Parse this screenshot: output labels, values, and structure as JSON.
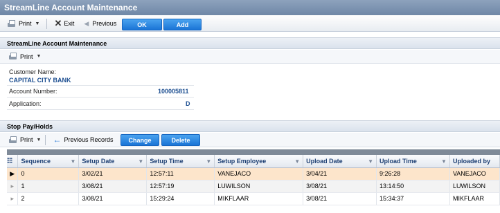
{
  "window": {
    "title": "StreamLine Account Maintenance"
  },
  "toolbar": {
    "print_label": "Print",
    "exit_label": "Exit",
    "previous_label": "Previous",
    "ok_label": "OK",
    "add_label": "Add"
  },
  "account_section": {
    "title": "StreamLine Account Maintenance",
    "print_label": "Print",
    "customer_name_label": "Customer Name:",
    "customer_name_value": "CAPITAL CITY BANK",
    "account_number_label": "Account Number:",
    "account_number_value": "100005811",
    "application_label": "Application:",
    "application_value": "D"
  },
  "stop_pay_section": {
    "title": "Stop Pay/Holds",
    "print_label": "Print",
    "previous_records_label": "Previous Records",
    "change_label": "Change",
    "delete_label": "Delete"
  },
  "grid": {
    "columns": [
      "Sequence",
      "Setup Date",
      "Setup Time",
      "Setup Employee",
      "Upload Date",
      "Upload Time",
      "Uploaded by"
    ],
    "rows": [
      [
        "0",
        "3/02/21",
        "12:57:11",
        "VANEJACO",
        "3/04/21",
        "9:26:28",
        "VANEJACO"
      ],
      [
        "1",
        "3/08/21",
        "12:57:19",
        "LUWILSON",
        "3/08/21",
        "13:14:50",
        "LUWILSON"
      ],
      [
        "2",
        "3/08/21",
        "15:29:24",
        "MIKFLAAR",
        "3/08/21",
        "15:34:37",
        "MIKFLAAR"
      ]
    ]
  },
  "colors": {
    "accent": "#1a74d6",
    "selected_row": "#fde5cb",
    "title_bar": "#6f87a6"
  }
}
